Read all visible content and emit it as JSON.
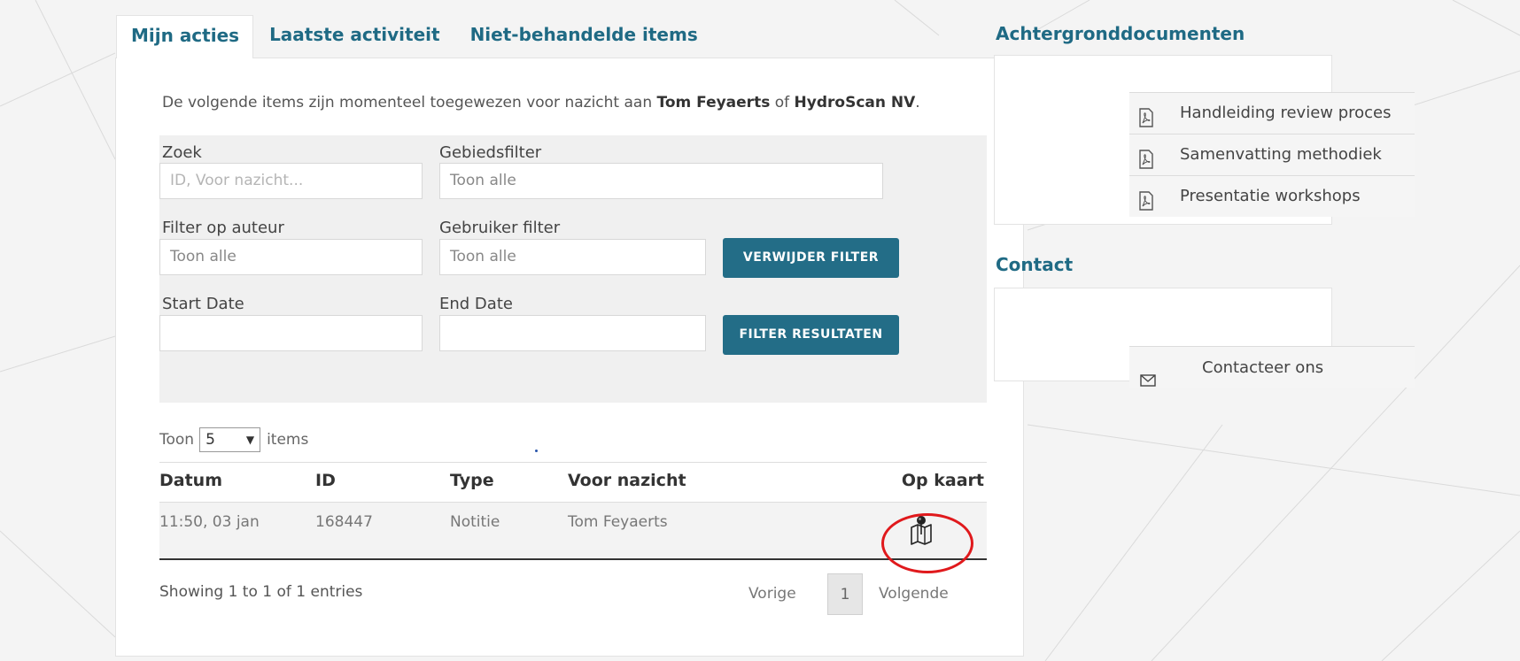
{
  "tabs": [
    "Mijn acties",
    "Laatste activiteit",
    "Niet-behandelde items"
  ],
  "intro": {
    "prefix": "De volgende items zijn momenteel toegewezen voor nazicht aan ",
    "user": "Tom Feyaerts",
    "middle": " of ",
    "company": "HydroScan NV",
    "suffix": "."
  },
  "filters": {
    "zoek_label": "Zoek",
    "zoek_placeholder": "ID, Voor nazicht...",
    "gebied_label": "Gebiedsfilter",
    "gebied_value": "Toon alle",
    "auteur_label": "Filter op auteur",
    "auteur_value": "Toon alle",
    "gebruiker_label": "Gebruiker filter",
    "gebruiker_value": "Toon alle",
    "start_label": "Start Date",
    "end_label": "End Date",
    "remove_button": "VERWIJDER FILTER",
    "apply_button": "FILTER RESULTATEN"
  },
  "paging": {
    "toon": "Toon",
    "count": "5",
    "items": "items"
  },
  "table": {
    "headers": [
      "Datum",
      "ID",
      "Type",
      "Voor nazicht",
      "Op kaart"
    ],
    "rows": [
      {
        "datum": "11:50, 03 jan",
        "id": "168447",
        "type": "Notitie",
        "voor_nazicht": "Tom Feyaerts",
        "op_kaart_icon": "map-pin-icon"
      }
    ]
  },
  "footer": {
    "showing": "Showing 1 to 1 of 1 entries",
    "prev": "Vorige",
    "page": "1",
    "next": "Volgende"
  },
  "sidebar": {
    "docs_title": "Achtergronddocumenten",
    "docs": [
      "Handleiding review proces",
      "Samenvatting methodiek",
      "Presentatie workshops"
    ],
    "contact_title": "Contact",
    "contact_link": "Contacteer ons"
  },
  "colors": {
    "accent": "#1f6a84",
    "button": "#236d87",
    "highlight_circle": "#e0191c"
  }
}
